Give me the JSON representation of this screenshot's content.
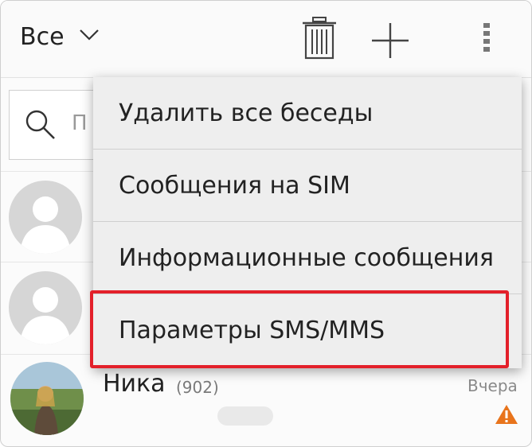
{
  "header": {
    "filter_label": "Все",
    "icons": [
      "chevron-down-icon",
      "trash-icon",
      "plus-icon",
      "overflow-menu-icon"
    ]
  },
  "search": {
    "placeholder": "П"
  },
  "menu": {
    "items": [
      {
        "label": "Удалить все беседы"
      },
      {
        "label": "Сообщения на SIM"
      },
      {
        "label": "Информационные сообщения"
      },
      {
        "label": "Параметры SMS/MMS"
      }
    ],
    "highlight_color": "#e3202a"
  },
  "conversations": [
    {
      "name": "",
      "avatar": "default-avatar-icon"
    },
    {
      "name": "",
      "avatar": "default-avatar-icon"
    },
    {
      "name": "Ника",
      "count": "(902)",
      "time": "Вчера",
      "status_icon": "warning-icon"
    }
  ]
}
